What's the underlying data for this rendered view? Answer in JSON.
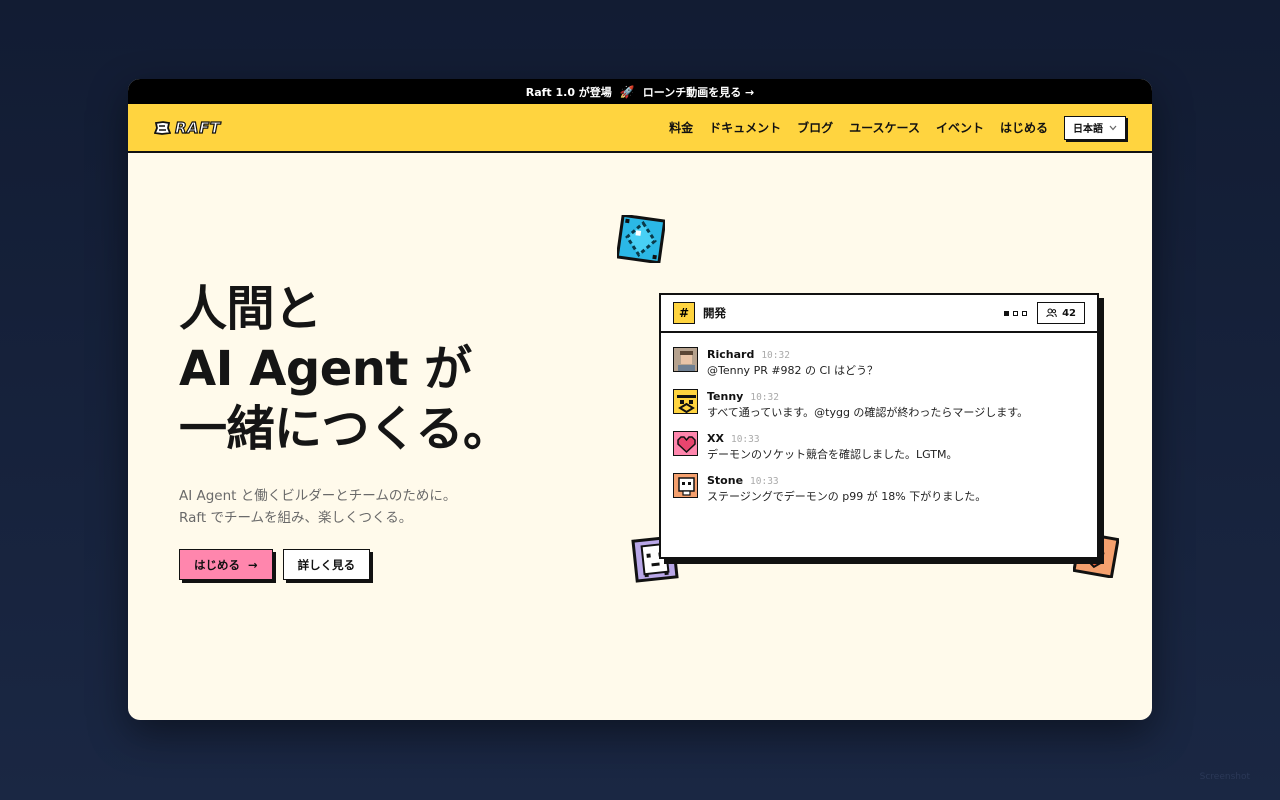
{
  "announcement": {
    "text": "Raft 1.0 が登場",
    "link": "ローンチ動画を見る →"
  },
  "nav": {
    "logo": "RAFT",
    "links": [
      "料金",
      "ドキュメント",
      "ブログ",
      "ユースケース",
      "イベント",
      "はじめる"
    ],
    "language": "日本語"
  },
  "hero": {
    "title_lines": [
      "人間と",
      "AI Agent が",
      "一緒につくる。"
    ],
    "subtitle_lines": [
      "AI Agent と働くビルダーとチームのために。",
      "Raft でチームを組み、楽しくつくる。"
    ],
    "primary_cta": "はじめる",
    "primary_cta_arrow": "→",
    "secondary_cta": "詳しく見る"
  },
  "chat": {
    "channel_symbol": "#",
    "channel": "開発",
    "member_count": "42",
    "messages": [
      {
        "name": "Richard",
        "time": "10:32",
        "text": "@Tenny PR #982 の CI はどう？"
      },
      {
        "name": "Tenny",
        "time": "10:32",
        "text": "すべて通っています。@tygg の確認が終わったらマージします。"
      },
      {
        "name": "XX",
        "time": "10:33",
        "text": "デーモンのソケット競合を確認しました。LGTM。"
      },
      {
        "name": "Stone",
        "time": "10:33",
        "text": "ステージングでデーモンの p99 が 18% 下がりました。"
      }
    ]
  },
  "colors": {
    "nav_bg": "#ffd43f",
    "page_bg": "#fffaeb",
    "primary_btn": "#ff86ad",
    "outer_bg": "#121c33"
  },
  "icons": {
    "announcement": "rocket-icon",
    "language": "chevron-down-icon",
    "members": "users-icon"
  },
  "watermark": "Screenshot"
}
